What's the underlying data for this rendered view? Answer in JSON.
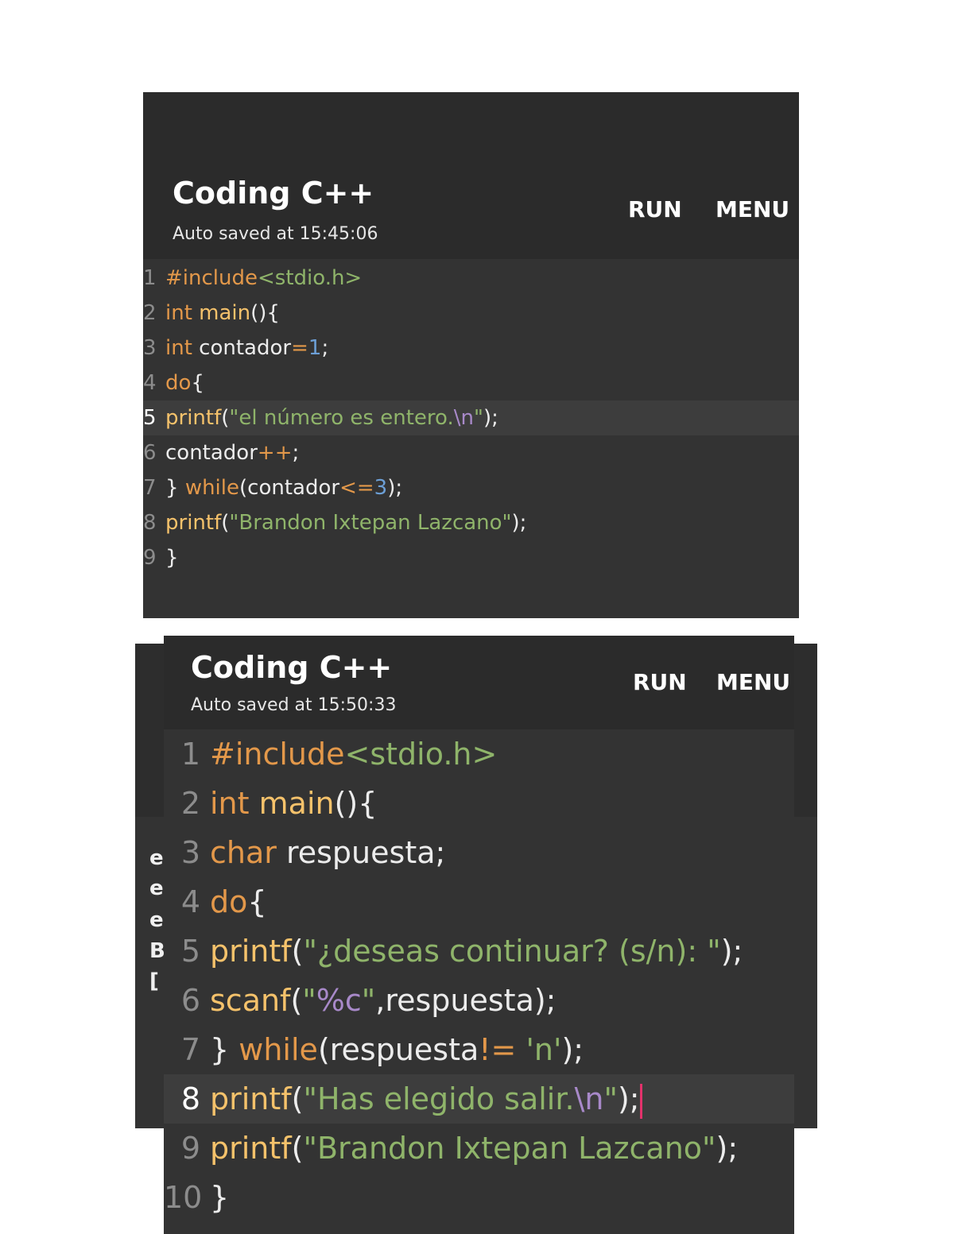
{
  "colors": {
    "background": "#2d2d2d",
    "editor": "#333333",
    "keyword": "#e3984a",
    "function": "#f5c26b",
    "string": "#8fb46a",
    "number": "#6c9fd6",
    "escape": "#a889c9",
    "caret": "#e3326b"
  },
  "screens": [
    {
      "title": "Coding C++",
      "saved": "Auto saved at 15:45:06",
      "run_label": "RUN",
      "menu_label": "MENU",
      "lines": [
        {
          "n": "1",
          "p": [
            "#include",
            "<stdio.h>"
          ]
        },
        {
          "n": "2",
          "p": [
            "int",
            " ",
            "main",
            "(){"
          ]
        },
        {
          "n": "3",
          "p": [
            "int",
            " contador",
            "=",
            "1",
            ";"
          ]
        },
        {
          "n": "4",
          "p": [
            "do",
            "{"
          ]
        },
        {
          "n": "5",
          "p": [
            "printf",
            "(",
            "\"el número es entero.",
            "\\n",
            "\"",
            ");"
          ]
        },
        {
          "n": "6",
          "p": [
            "contador",
            "++",
            ";"
          ]
        },
        {
          "n": "7",
          "p": [
            "} ",
            "while",
            "(contador",
            "<=",
            "3",
            ");"
          ]
        },
        {
          "n": "8",
          "p": [
            "printf",
            "(",
            "\"Brandon Ixtepan Lazcano\"",
            ");"
          ]
        },
        {
          "n": "9",
          "p": [
            "}"
          ]
        }
      ]
    },
    {
      "title": "Coding C++",
      "saved": "Auto saved at 15:50:33",
      "run_label": "RUN",
      "menu_label": "MENU",
      "lines": [
        {
          "n": "1",
          "p": [
            "#include",
            "<stdio.h>"
          ]
        },
        {
          "n": "2",
          "p": [
            "int",
            " ",
            "main",
            "(){"
          ]
        },
        {
          "n": "3",
          "p": [
            "char",
            " respuesta;"
          ]
        },
        {
          "n": "4",
          "p": [
            "do",
            "{"
          ]
        },
        {
          "n": "5",
          "p": [
            "printf",
            "(",
            "\"¿deseas continuar? (s/n): \"",
            ");"
          ]
        },
        {
          "n": "6",
          "p": [
            "scanf",
            "(",
            "\"",
            "%c",
            "\"",
            ",respuesta);"
          ]
        },
        {
          "n": "7",
          "p": [
            "} ",
            "while",
            "(respuesta",
            "!=",
            " ",
            "'n'",
            ");"
          ]
        },
        {
          "n": "8",
          "p": [
            "printf",
            "(",
            "\"Has elegido salir.",
            "\\n",
            "\"",
            ");"
          ]
        },
        {
          "n": "9",
          "p": [
            "printf",
            "(",
            "\"Brandon Ixtepan Lazcano\"",
            ");"
          ]
        },
        {
          "n": "10",
          "p": [
            "}"
          ]
        }
      ]
    }
  ],
  "side_chars": [
    "e",
    "e",
    "e",
    "B",
    "["
  ]
}
